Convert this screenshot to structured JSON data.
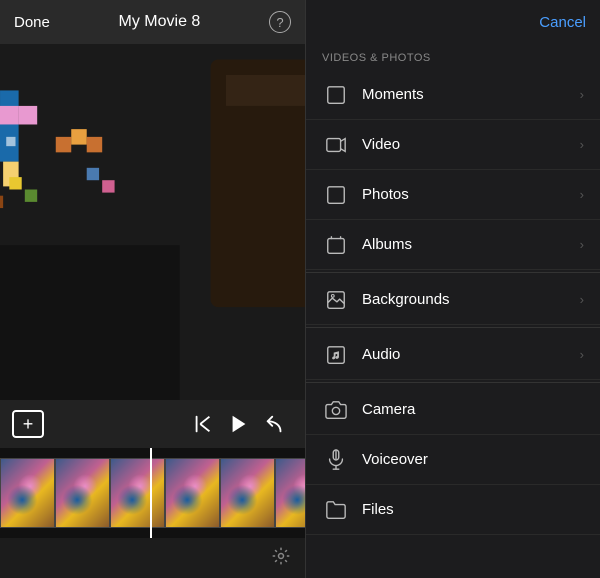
{
  "leftPanel": {
    "topBar": {
      "done": "Done",
      "title": "My Movie 8",
      "help": "?"
    },
    "controls": {
      "add": "+",
      "skipBack": "⏮",
      "play": "▶",
      "undo": "↩"
    },
    "settings": "⚙"
  },
  "rightPanel": {
    "cancel": "Cancel",
    "sectionLabel": "VIDEOS & PHOTOS",
    "menuItems": [
      {
        "id": "moments",
        "label": "Moments",
        "icon": "square",
        "hasChevron": true
      },
      {
        "id": "video",
        "label": "Video",
        "icon": "film",
        "hasChevron": true
      },
      {
        "id": "photos",
        "label": "Photos",
        "icon": "square",
        "hasChevron": true
      },
      {
        "id": "albums",
        "label": "Albums",
        "icon": "square",
        "hasChevron": true
      },
      {
        "id": "backgrounds",
        "label": "Backgrounds",
        "icon": "image",
        "hasChevron": true
      },
      {
        "id": "audio",
        "label": "Audio",
        "icon": "music",
        "hasChevron": true
      },
      {
        "id": "camera",
        "label": "Camera",
        "icon": "camera",
        "hasChevron": false
      },
      {
        "id": "voiceover",
        "label": "Voiceover",
        "icon": "mic",
        "hasChevron": false
      },
      {
        "id": "files",
        "label": "Files",
        "icon": "folder",
        "hasChevron": false
      }
    ]
  }
}
